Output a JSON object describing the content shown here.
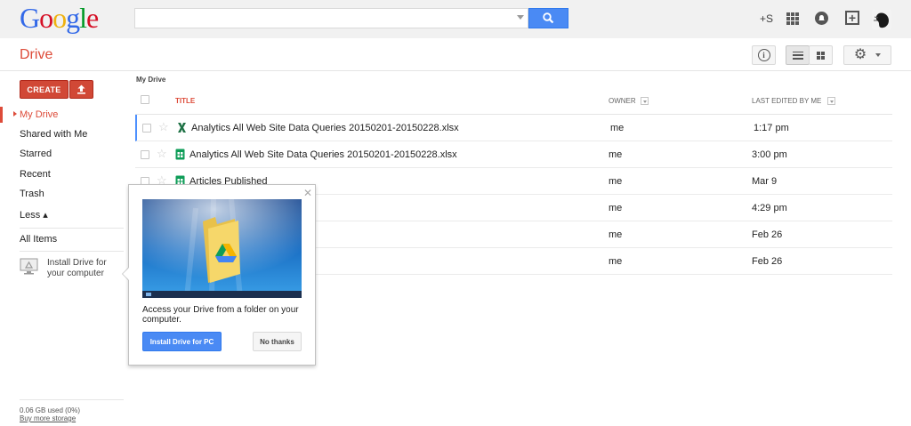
{
  "header": {
    "logo_letters": [
      {
        "ch": "G",
        "color": "#3369e8"
      },
      {
        "ch": "o",
        "color": "#d50f25"
      },
      {
        "ch": "o",
        "color": "#eeb211"
      },
      {
        "ch": "g",
        "color": "#3369e8"
      },
      {
        "ch": "l",
        "color": "#009925"
      },
      {
        "ch": "e",
        "color": "#d50f25"
      }
    ],
    "search_value": "",
    "plus_user": "+S"
  },
  "subbar": {
    "title": "Drive"
  },
  "sidebar": {
    "create_label": "CREATE",
    "items": [
      {
        "label": "My Drive",
        "active": true
      },
      {
        "label": "Shared with Me"
      },
      {
        "label": "Starred"
      },
      {
        "label": "Recent"
      },
      {
        "label": "Trash"
      },
      {
        "label": "Less ▴"
      },
      {
        "label": "All Items"
      }
    ],
    "install_text": "Install Drive for your computer",
    "storage_used": "0.06 GB used (0%)",
    "buy_storage": "Buy more storage"
  },
  "main": {
    "breadcrumb": "My Drive",
    "columns": {
      "title": "TITLE",
      "owner": "OWNER",
      "last_edited": "LAST EDITED BY ME"
    },
    "rows": [
      {
        "name": "Analytics All Web Site Data Queries 20150201-20150228.xlsx",
        "type": "excel",
        "owner": "me",
        "edited": "1:17 pm"
      },
      {
        "name": "Analytics All Web Site Data Queries 20150201-20150228.xlsx",
        "type": "sheet",
        "owner": "me",
        "edited": "3:00 pm"
      },
      {
        "name": "Articles Published",
        "type": "sheet",
        "owner": "me",
        "edited": "Mar 9"
      },
      {
        "name": "",
        "type": "",
        "owner": "me",
        "edited": "4:29 pm"
      },
      {
        "name": "",
        "type": "",
        "owner": "me",
        "edited": "Feb 26"
      },
      {
        "name": "",
        "type": "",
        "owner": "me",
        "edited": "Feb 26"
      }
    ]
  },
  "popup": {
    "text": "Access your Drive from a folder on your computer.",
    "install_button": "Install Drive for PC",
    "no_thanks_button": "No thanks"
  },
  "colors": {
    "accent_red": "#dd4b39",
    "create_red": "#d14836",
    "blue_button": "#4a8af4",
    "excel_green": "#1e7145",
    "sheets_green": "#0f9d58"
  }
}
